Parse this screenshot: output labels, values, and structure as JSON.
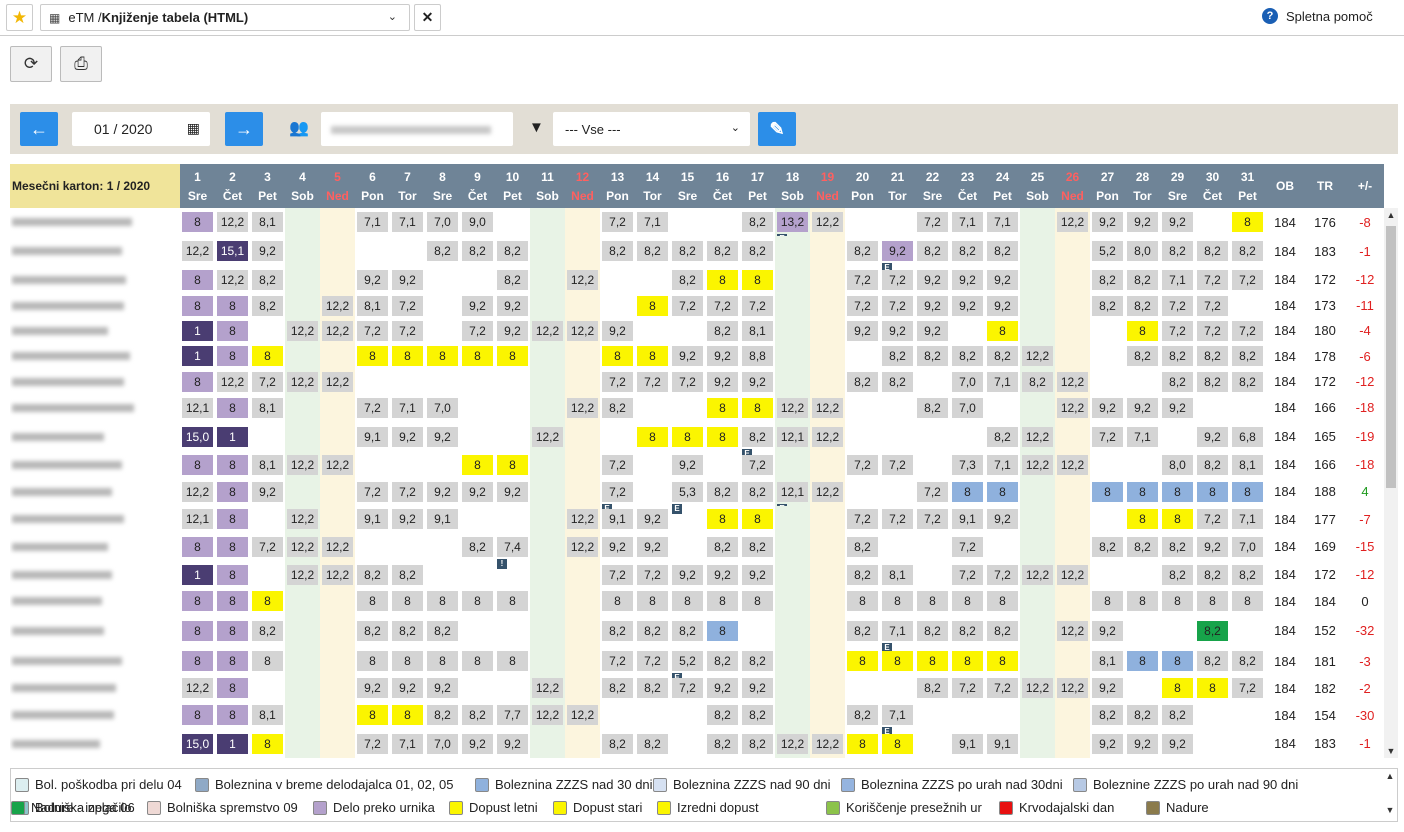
{
  "header": {
    "star_icon": "star-icon",
    "tab_prefix": "eTM / ",
    "tab_title": "Knjiženje tabela (HTML)",
    "help_label": "Spletna pomoč"
  },
  "toolbar": {
    "refresh_icon": "refresh-icon",
    "print_icon": "print-icon"
  },
  "filters": {
    "month_value": "01 / 2020",
    "select_value": "--- Vse ---"
  },
  "table": {
    "title": "Mesečni karton: 1 / 2020",
    "summary_headers": [
      "OB",
      "TR",
      "+/-"
    ],
    "days": [
      {
        "n": "1",
        "w": "Sre",
        "t": "d"
      },
      {
        "n": "2",
        "w": "Čet",
        "t": "d"
      },
      {
        "n": "3",
        "w": "Pet",
        "t": "d"
      },
      {
        "n": "4",
        "w": "Sob",
        "t": "sat"
      },
      {
        "n": "5",
        "w": "Ned",
        "t": "sun"
      },
      {
        "n": "6",
        "w": "Pon",
        "t": "d"
      },
      {
        "n": "7",
        "w": "Tor",
        "t": "d"
      },
      {
        "n": "8",
        "w": "Sre",
        "t": "d"
      },
      {
        "n": "9",
        "w": "Čet",
        "t": "d"
      },
      {
        "n": "10",
        "w": "Pet",
        "t": "d"
      },
      {
        "n": "11",
        "w": "Sob",
        "t": "sat"
      },
      {
        "n": "12",
        "w": "Ned",
        "t": "sun"
      },
      {
        "n": "13",
        "w": "Pon",
        "t": "d"
      },
      {
        "n": "14",
        "w": "Tor",
        "t": "d"
      },
      {
        "n": "15",
        "w": "Sre",
        "t": "d"
      },
      {
        "n": "16",
        "w": "Čet",
        "t": "d"
      },
      {
        "n": "17",
        "w": "Pet",
        "t": "d"
      },
      {
        "n": "18",
        "w": "Sob",
        "t": "sat"
      },
      {
        "n": "19",
        "w": "Ned",
        "t": "sun"
      },
      {
        "n": "20",
        "w": "Pon",
        "t": "d"
      },
      {
        "n": "21",
        "w": "Tor",
        "t": "d"
      },
      {
        "n": "22",
        "w": "Sre",
        "t": "d"
      },
      {
        "n": "23",
        "w": "Čet",
        "t": "d"
      },
      {
        "n": "24",
        "w": "Pet",
        "t": "d"
      },
      {
        "n": "25",
        "w": "Sob",
        "t": "sat"
      },
      {
        "n": "26",
        "w": "Ned",
        "t": "sun"
      },
      {
        "n": "27",
        "w": "Pon",
        "t": "d"
      },
      {
        "n": "28",
        "w": "Tor",
        "t": "d"
      },
      {
        "n": "29",
        "w": "Sre",
        "t": "d"
      },
      {
        "n": "30",
        "w": "Čet",
        "t": "d"
      },
      {
        "n": "31",
        "w": "Pet",
        "t": "d"
      }
    ],
    "rows": [
      {
        "c": [
          "8p",
          "12,2g",
          "8,1g",
          "",
          "",
          "7,1g",
          "7,1g",
          "7,0g",
          "9,0g",
          "",
          "",
          "",
          "7,2g",
          "7,1g",
          "",
          "",
          "8,2g",
          "13,2m|E",
          "12,2g",
          "",
          "",
          "7,2g",
          "7,1g",
          "7,1g",
          "",
          "12,2g",
          "9,2g",
          "9,2g",
          "9,2g",
          "",
          "8y"
        ],
        "ob": "184",
        "tr": "176",
        "d": "-8"
      },
      {
        "c": [
          "12,2g",
          "15,1d",
          "9,2g",
          "",
          "",
          "",
          "",
          "8,2g",
          "8,2g",
          "8,2g",
          "",
          "",
          "8,2g",
          "8,2g",
          "8,2g",
          "8,2g",
          "8,2g",
          "",
          "",
          "8,2g",
          "9,2m|E",
          "8,2g",
          "8,2g",
          "8,2g",
          "",
          "",
          "5,2g",
          "8,0g",
          "8,2g",
          "8,2g",
          "8,2g"
        ],
        "ob": "184",
        "tr": "183",
        "d": "-1"
      },
      {
        "c": [
          "8p",
          "12,2g",
          "8,2g",
          "",
          "",
          "9,2g",
          "9,2g",
          "",
          "",
          "8,2g",
          "",
          "12,2g",
          "",
          "",
          "8,2g",
          "8y",
          "8y",
          "",
          "",
          "7,2g",
          "7,2g",
          "9,2g",
          "9,2g",
          "9,2g",
          "",
          "",
          "8,2g",
          "8,2g",
          "7,1g",
          "7,2g",
          "7,2g"
        ],
        "ob": "184",
        "tr": "172",
        "d": "-12"
      },
      {
        "c": [
          "8p",
          "8p",
          "8,2g",
          "",
          "12,2g",
          "8,1g",
          "7,2g",
          "",
          "9,2g",
          "9,2g",
          "",
          "",
          "",
          "8y",
          "7,2g",
          "7,2g",
          "7,2g",
          "",
          "",
          "7,2g",
          "7,2g",
          "9,2g",
          "9,2g",
          "9,2g",
          "",
          "",
          "8,2g",
          "8,2g",
          "7,2g",
          "7,2g",
          ""
        ],
        "ob": "184",
        "tr": "173",
        "d": "-11"
      },
      {
        "c": [
          "1d",
          "8p",
          "",
          "12,2g",
          "12,2g",
          "7,2g",
          "7,2g",
          "",
          "7,2g",
          "9,2g",
          "12,2g",
          "12,2g",
          "9,2g",
          "",
          "",
          "8,2g",
          "8,1g",
          "",
          "",
          "9,2g",
          "9,2g",
          "9,2g",
          "",
          "8y",
          "",
          "",
          "",
          "8y",
          "7,2g",
          "7,2g",
          "7,2g"
        ],
        "ob": "184",
        "tr": "180",
        "d": "-4"
      },
      {
        "c": [
          "1d",
          "8p",
          "8y",
          "",
          "",
          "8y",
          "8y",
          "8y",
          "8y",
          "8y",
          "",
          "",
          "8y",
          "8y",
          "9,2g",
          "9,2g",
          "8,8g",
          "",
          "",
          "",
          "8,2g",
          "8,2g",
          "8,2g",
          "8,2g",
          "12,2g",
          "",
          "",
          "8,2g",
          "8,2g",
          "8,2g",
          "8,2g"
        ],
        "ob": "184",
        "tr": "178",
        "d": "-6"
      },
      {
        "c": [
          "8p",
          "12,2g",
          "7,2g",
          "12,2g",
          "12,2g",
          "",
          "",
          "",
          "",
          "",
          "",
          "",
          "7,2g",
          "7,2g",
          "7,2g",
          "9,2g",
          "9,2g",
          "",
          "",
          "8,2g",
          "8,2g",
          "",
          "7,0g",
          "7,1g",
          "8,2g",
          "12,2g",
          "",
          "",
          "8,2g",
          "8,2g",
          "8,2g"
        ],
        "ob": "184",
        "tr": "172",
        "d": "-12"
      },
      {
        "c": [
          "12,1g",
          "8p",
          "8,1g",
          "",
          "",
          "7,2g",
          "7,1g",
          "7,0g",
          "",
          "",
          "",
          "12,2g",
          "8,2g",
          "",
          "",
          "8y",
          "8y",
          "12,2g",
          "12,2g",
          "",
          "",
          "8,2g",
          "7,0g",
          "",
          "",
          "12,2g",
          "9,2g",
          "9,2g",
          "9,2g",
          "",
          ""
        ],
        "ob": "184",
        "tr": "166",
        "d": "-18"
      },
      {
        "c": [
          "15,0d",
          "1d",
          "",
          "",
          "",
          "9,1g",
          "9,2g",
          "9,2g",
          "",
          "",
          "12,2g",
          "",
          "",
          "8y",
          "8y",
          "8y",
          "8,2g|E",
          "12,1g",
          "12,2g",
          "",
          "",
          "",
          "",
          "8,2g",
          "12,2g",
          "",
          "7,2g",
          "7,1g",
          "",
          "9,2g",
          "6,8g"
        ],
        "ob": "184",
        "tr": "165",
        "d": "-19"
      },
      {
        "c": [
          "8p",
          "8p",
          "8,1g",
          "12,2g",
          "12,2g",
          "",
          "",
          "",
          "8y",
          "8y",
          "",
          "",
          "7,2g",
          "",
          "9,2g",
          "",
          "7,2g",
          "",
          "",
          "7,2g",
          "7,2g",
          "",
          "7,3g",
          "7,1g",
          "12,2g",
          "12,2g",
          "",
          "",
          "8,0g",
          "8,2g",
          "8,1g"
        ],
        "ob": "184",
        "tr": "166",
        "d": "-18"
      },
      {
        "c": [
          "12,2g",
          "8p",
          "9,2g",
          "",
          "",
          "7,2g",
          "7,2g",
          "9,2g",
          "9,2g",
          "9,2g",
          "",
          "",
          "7,2g|E",
          "",
          "5,3g|E",
          "8,2g",
          "8,2g",
          "12,1g|E",
          "12,2g",
          "",
          "",
          "7,2g",
          "8b",
          "8b",
          "",
          "",
          "8b",
          "8b",
          "8b",
          "8b",
          "8b"
        ],
        "ob": "184",
        "tr": "188",
        "d": "4"
      },
      {
        "c": [
          "12,1g",
          "8p",
          "",
          "12,2g",
          "",
          "9,1g",
          "9,2g",
          "9,1g",
          "",
          "",
          "",
          "12,2g",
          "9,1g",
          "9,2g",
          "",
          "8y",
          "8y",
          "",
          "",
          "7,2g",
          "7,2g",
          "7,2g",
          "9,1g",
          "9,2g",
          "",
          "",
          "",
          "8y",
          "8y",
          "7,2g",
          "7,1g"
        ],
        "ob": "184",
        "tr": "177",
        "d": "-7"
      },
      {
        "c": [
          "8p",
          "8p",
          "7,2g",
          "12,2g",
          "12,2g",
          "",
          "",
          "",
          "8,2g",
          "7,4g|!",
          "",
          "12,2g",
          "9,2g",
          "9,2g",
          "",
          "8,2g",
          "8,2g",
          "",
          "",
          "8,2g",
          "",
          "",
          "7,2g",
          "",
          "",
          "",
          "8,2g",
          "8,2g",
          "8,2g",
          "9,2g",
          "7,0g"
        ],
        "ob": "184",
        "tr": "169",
        "d": "-15"
      },
      {
        "c": [
          "1d",
          "8p",
          "",
          "12,2g",
          "12,2g",
          "8,2g",
          "8,2g",
          "",
          "",
          "",
          "",
          "",
          "7,2g",
          "7,2g",
          "9,2g",
          "9,2g",
          "9,2g",
          "",
          "",
          "8,2g",
          "8,1g",
          "",
          "7,2g",
          "7,2g",
          "12,2g",
          "12,2g",
          "",
          "",
          "8,2g",
          "8,2g",
          "8,2g"
        ],
        "ob": "184",
        "tr": "172",
        "d": "-12"
      },
      {
        "c": [
          "8p",
          "8p",
          "8y",
          "",
          "",
          "8g",
          "8g",
          "8g",
          "8g",
          "8g",
          "",
          "",
          "8g",
          "8g",
          "8g",
          "8g",
          "8g",
          "",
          "",
          "8g",
          "8g",
          "8g",
          "8g",
          "8g",
          "",
          "",
          "8g",
          "8g",
          "8g",
          "8g",
          "8g"
        ],
        "ob": "184",
        "tr": "184",
        "d": "0"
      },
      {
        "c": [
          "8p",
          "8p",
          "8,2g",
          "",
          "",
          "8,2g",
          "8,2g",
          "8,2g",
          "",
          "",
          "",
          "",
          "8,2g",
          "8,2g",
          "8,2g",
          "8b",
          "",
          "",
          "",
          "8,2g",
          "7,1g|E",
          "8,2g",
          "8,2g",
          "8,2g",
          "",
          "12,2g",
          "9,2g",
          "",
          "",
          "8,2x",
          ""
        ],
        "ob": "184",
        "tr": "152",
        "d": "-32"
      },
      {
        "c": [
          "8p",
          "8p",
          "8g",
          "",
          "",
          "8g",
          "8g",
          "8g",
          "8g",
          "8g",
          "",
          "",
          "7,2g",
          "7,2g",
          "5,2g|E",
          "8,2g",
          "8,2g",
          "",
          "",
          "8y",
          "8y",
          "8y",
          "8y",
          "8y",
          "",
          "",
          "8,1g",
          "8b",
          "8b",
          "8,2g",
          "8,2g"
        ],
        "ob": "184",
        "tr": "181",
        "d": "-3"
      },
      {
        "c": [
          "12,2g",
          "8p",
          "",
          "",
          "",
          "9,2g",
          "9,2g",
          "9,2g",
          "",
          "",
          "12,2g",
          "",
          "8,2g",
          "8,2g",
          "7,2g",
          "9,2g",
          "9,2g",
          "",
          "",
          "",
          "",
          "8,2g",
          "7,2g",
          "7,2g",
          "12,2g",
          "12,2g",
          "9,2g",
          "",
          "8y",
          "8y",
          "7,2g"
        ],
        "ob": "184",
        "tr": "182",
        "d": "-2"
      },
      {
        "c": [
          "8p",
          "8p",
          "8,1g",
          "",
          "",
          "8y",
          "8y",
          "8,2g",
          "8,2g",
          "7,7g",
          "12,2g",
          "12,2g",
          "",
          "",
          "",
          "8,2g",
          "8,2g",
          "",
          "",
          "8,2g",
          "7,1g|E",
          "",
          "",
          "",
          "",
          "",
          "8,2g",
          "8,2g",
          "8,2g",
          "",
          ""
        ],
        "ob": "184",
        "tr": "154",
        "d": "-30"
      },
      {
        "c": [
          "15,0d",
          "1d",
          "8y",
          "",
          "",
          "7,2g",
          "7,1g",
          "7,0g",
          "9,2g",
          "9,2g",
          "",
          "",
          "8,2g",
          "8,2g",
          "",
          "8,2g",
          "8,2g",
          "12,2g",
          "12,2g",
          "8y",
          "8y",
          "",
          "9,1g",
          "9,1g",
          "",
          "",
          "9,2g",
          "9,2g",
          "9,2g",
          "",
          ""
        ],
        "ob": "184",
        "tr": "183",
        "d": "-1"
      }
    ]
  },
  "colors": {
    "g": "#d4d4d4",
    "p": "#b4a1cc",
    "d": "#4a3d72",
    "y": "#fbf500",
    "b": "#8fb1dd",
    "m": "#b4a1cc",
    "x": "#17a34a",
    "header_bg": "#6f8497",
    "title_bg": "#f0e49a",
    "accent_blue": "#2c8ee8",
    "sat_bg": "#e8f3e6",
    "sun_bg": "#fcf5de",
    "neg": "#e02020",
    "pos": "#1f9a1f"
  },
  "legend": [
    {
      "label": "Bol. poškodba pri delu 04",
      "color": "#dceef0"
    },
    {
      "label": "Boleznina v breme delodajalca 01, 02, 05",
      "color": "#8fa9c6"
    },
    {
      "label": "Boleznina ZZZS nad 30 dni",
      "color": "#8fb1dd"
    },
    {
      "label": "Boleznina ZZZS nad 90 dni",
      "color": "#d6e1f2"
    },
    {
      "label": "Boleznina ZZZS po urah nad 30dni",
      "color": "#95b4df"
    },
    {
      "label": "Boleznine ZZZS po urah nad 90 dni",
      "color": "#b7c9e4"
    },
    {
      "label": "Bolniška nega 06",
      "color": "#8ec6cc"
    },
    {
      "label": "Bolniška spremstvo 09",
      "color": "#efd9d5"
    },
    {
      "label": "Delo preko urnika",
      "color": "#b4a1cc"
    },
    {
      "label": "Dopust letni",
      "color": "#fbf500"
    },
    {
      "label": "Dopust stari",
      "color": "#fbf500"
    },
    {
      "label": "Izredni dopust",
      "color": "#fbf500"
    },
    {
      "label": "Koriščenje presežnih ur",
      "color": "#8cc34a"
    },
    {
      "label": "Krvodajalski dan",
      "color": "#e81010"
    },
    {
      "label": "Nadure",
      "color": "#8b7b4c"
    },
    {
      "label": "Nadure - izplačilo",
      "color": "#17a34a"
    }
  ]
}
